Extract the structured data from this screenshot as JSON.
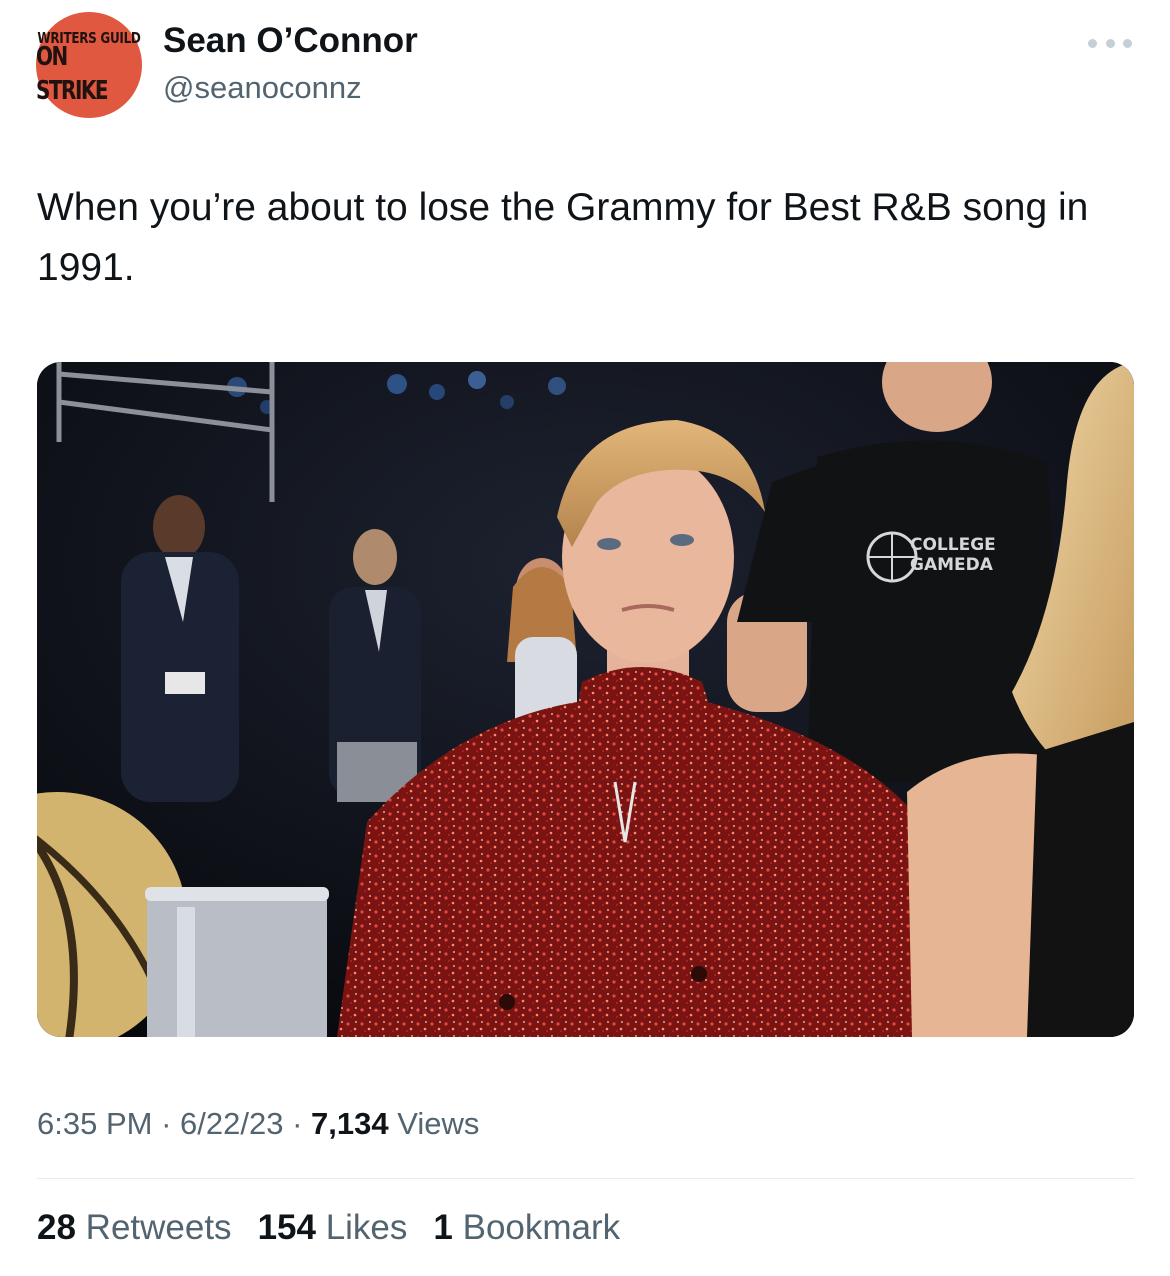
{
  "author": {
    "display_name": "Sean O’Connor",
    "handle": "@seanoconnz",
    "avatar_line1": "WRITERS GUILD",
    "avatar_line2": "ON STRIKE"
  },
  "tweet": {
    "text": "When you’re about to lose the Grammy for Best R&B song in 1991.",
    "media_icon": "photo",
    "shirt_text_line1": "COLLEGE",
    "shirt_text_line2": "GAMEDA"
  },
  "meta": {
    "time": "6:35 PM",
    "sep1": " · ",
    "date": "6/22/23",
    "sep2": " · ",
    "views_count": "7,134",
    "views_label": " Views"
  },
  "stats": {
    "retweets_count": "28",
    "retweets_label": " Retweets",
    "likes_count": "154",
    "likes_label": " Likes",
    "bookmarks_count": "1",
    "bookmarks_label": " Bookmark"
  },
  "icons": {
    "more": "more-horizontal-icon"
  },
  "colors": {
    "avatar_bg": "#e0583f",
    "secondary_text": "#536471",
    "primary_text": "#0f1419"
  }
}
